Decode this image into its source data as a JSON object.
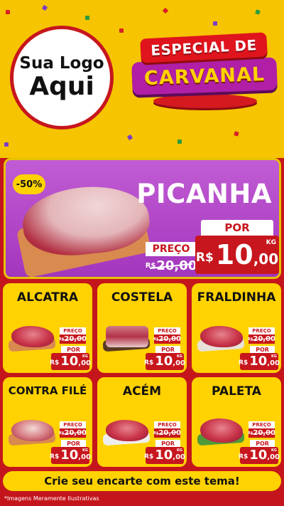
{
  "logo": {
    "line1": "Sua Logo",
    "line2": "Aqui"
  },
  "title": {
    "line1": "ESPECIAL DE",
    "line2": "CARVANAL"
  },
  "hero": {
    "discount": "-50%",
    "name": "PICANHA",
    "preco_label": "PREÇO",
    "old_currency": "R$",
    "old_price": "20,00",
    "por_label": "POR",
    "currency": "R$",
    "price_int": "10",
    "price_dec": ",00",
    "unit": "KG"
  },
  "products": [
    {
      "name": "ALCATRA",
      "preco_label": "PREÇO",
      "old_currency": "R$",
      "old_price": "20,00",
      "por_label": "POR",
      "currency": "R$",
      "price_int": "10",
      "price_dec": ",00",
      "unit": "KG"
    },
    {
      "name": "COSTELA",
      "preco_label": "PREÇO",
      "old_currency": "R$",
      "old_price": "20,00",
      "por_label": "POR",
      "currency": "R$",
      "price_int": "10",
      "price_dec": ",00",
      "unit": "KG"
    },
    {
      "name": "FRALDINHA",
      "preco_label": "PREÇO",
      "old_currency": "R$",
      "old_price": "20,00",
      "por_label": "POR",
      "currency": "R$",
      "price_int": "10",
      "price_dec": ",00",
      "unit": "KG"
    },
    {
      "name": "CONTRA FILÉ",
      "preco_label": "PREÇO",
      "old_currency": "R$",
      "old_price": "20,00",
      "por_label": "POR",
      "currency": "R$",
      "price_int": "10",
      "price_dec": ",00",
      "unit": "KG"
    },
    {
      "name": "ACÉM",
      "preco_label": "PREÇO",
      "old_currency": "R$",
      "old_price": "20,00",
      "por_label": "POR",
      "currency": "R$",
      "price_int": "10",
      "price_dec": ",00",
      "unit": "KG"
    },
    {
      "name": "PALETA",
      "preco_label": "PREÇO",
      "old_currency": "R$",
      "old_price": "20,00",
      "por_label": "POR",
      "currency": "R$",
      "price_int": "10",
      "price_dec": ",00",
      "unit": "KG"
    }
  ],
  "cta": "Crie seu encarte com este tema!",
  "footnote": "*Imagens Meramente Ilustrativas",
  "colors": {
    "yellow": "#ffd200",
    "red": "#c5151c",
    "purple": "#a236bd"
  }
}
